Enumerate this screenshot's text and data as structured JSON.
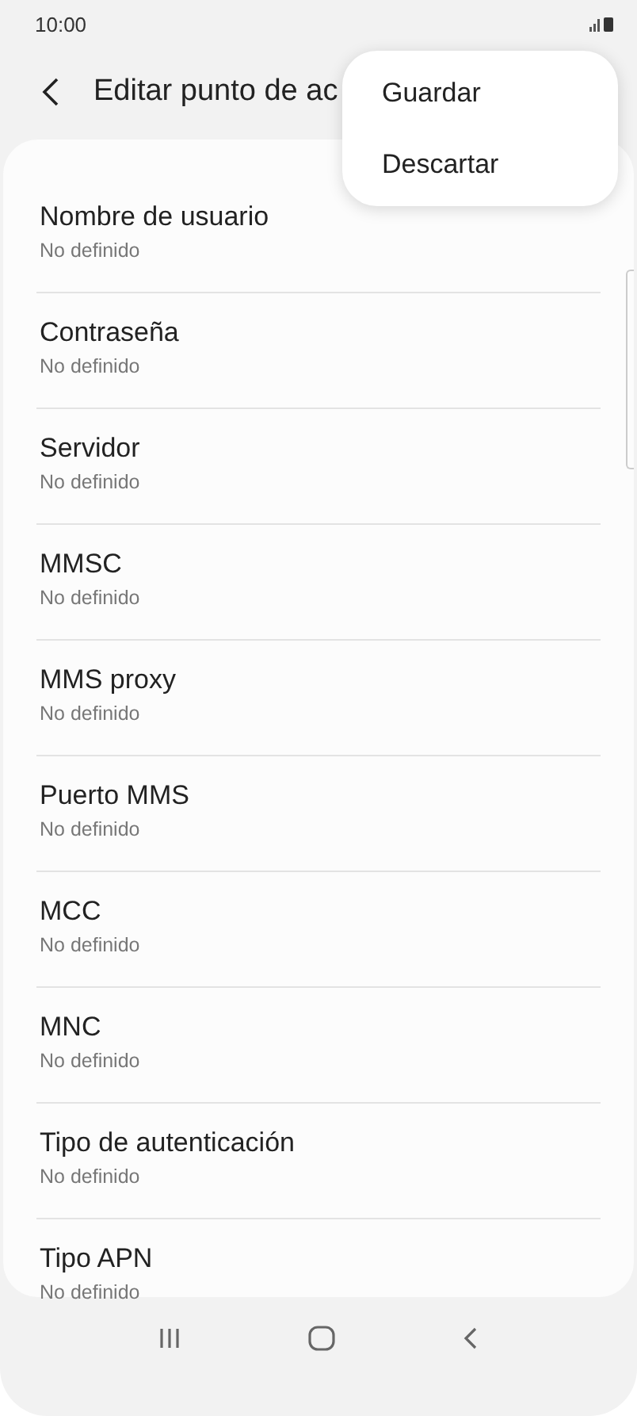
{
  "status_bar": {
    "time": "10:00"
  },
  "header": {
    "title": "Editar punto de ac"
  },
  "menu": [
    {
      "label": "Guardar"
    },
    {
      "label": "Descartar"
    }
  ],
  "settings": [
    {
      "label": "Nombre de usuario",
      "value": "No definido"
    },
    {
      "label": "Contraseña",
      "value": "No definido"
    },
    {
      "label": "Servidor",
      "value": "No definido"
    },
    {
      "label": "MMSC",
      "value": "No definido"
    },
    {
      "label": "MMS proxy",
      "value": "No definido"
    },
    {
      "label": "Puerto MMS",
      "value": "No definido"
    },
    {
      "label": "MCC",
      "value": "No definido"
    },
    {
      "label": "MNC",
      "value": "No definido"
    },
    {
      "label": "Tipo de autenticación",
      "value": "No definido"
    },
    {
      "label": "Tipo APN",
      "value": "No definido"
    }
  ]
}
